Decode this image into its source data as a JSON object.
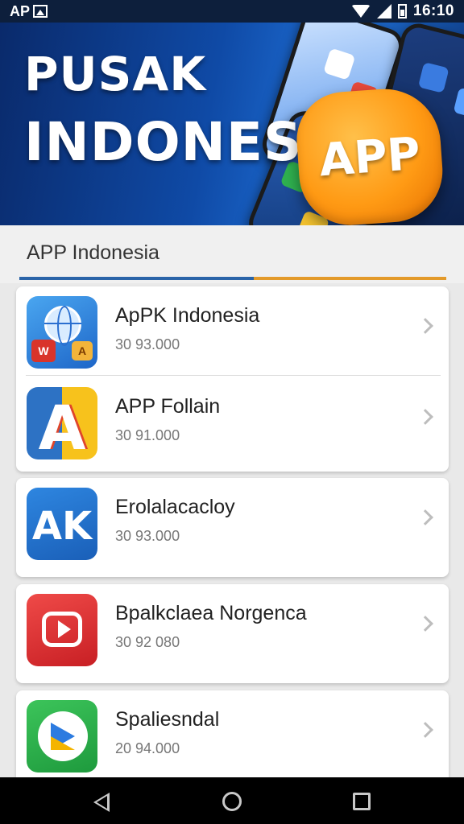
{
  "status_bar": {
    "carrier": "AP",
    "time": "16:10",
    "icons": [
      "image-icon",
      "wifi-icon",
      "signal-icon",
      "battery-icon"
    ]
  },
  "banner": {
    "title_line1": "PUSAK",
    "title_line2": "INDONESIA",
    "badge_text": "APP"
  },
  "section": {
    "title": "APP Indonesia"
  },
  "apps": [
    {
      "name": "ApPK Indonesia",
      "meta": "30 93.000",
      "icon": "globe-app-icon"
    },
    {
      "name": "APP Follain",
      "meta": "30 91.000",
      "icon": "letter-a-app-icon"
    },
    {
      "name": "Erolalacacloy",
      "meta": "30 93.000",
      "icon": "ak-app-icon"
    },
    {
      "name": "Bpalkclaea Norgenca",
      "meta": "30 92 080",
      "icon": "play-app-icon"
    },
    {
      "name": "Spaliesndal",
      "meta": "20 94.000",
      "icon": "chat-app-icon"
    }
  ],
  "colors": {
    "accent_blue": "#2a64a8",
    "accent_orange": "#e39a2a",
    "badge_orange": "#ff9a14"
  }
}
